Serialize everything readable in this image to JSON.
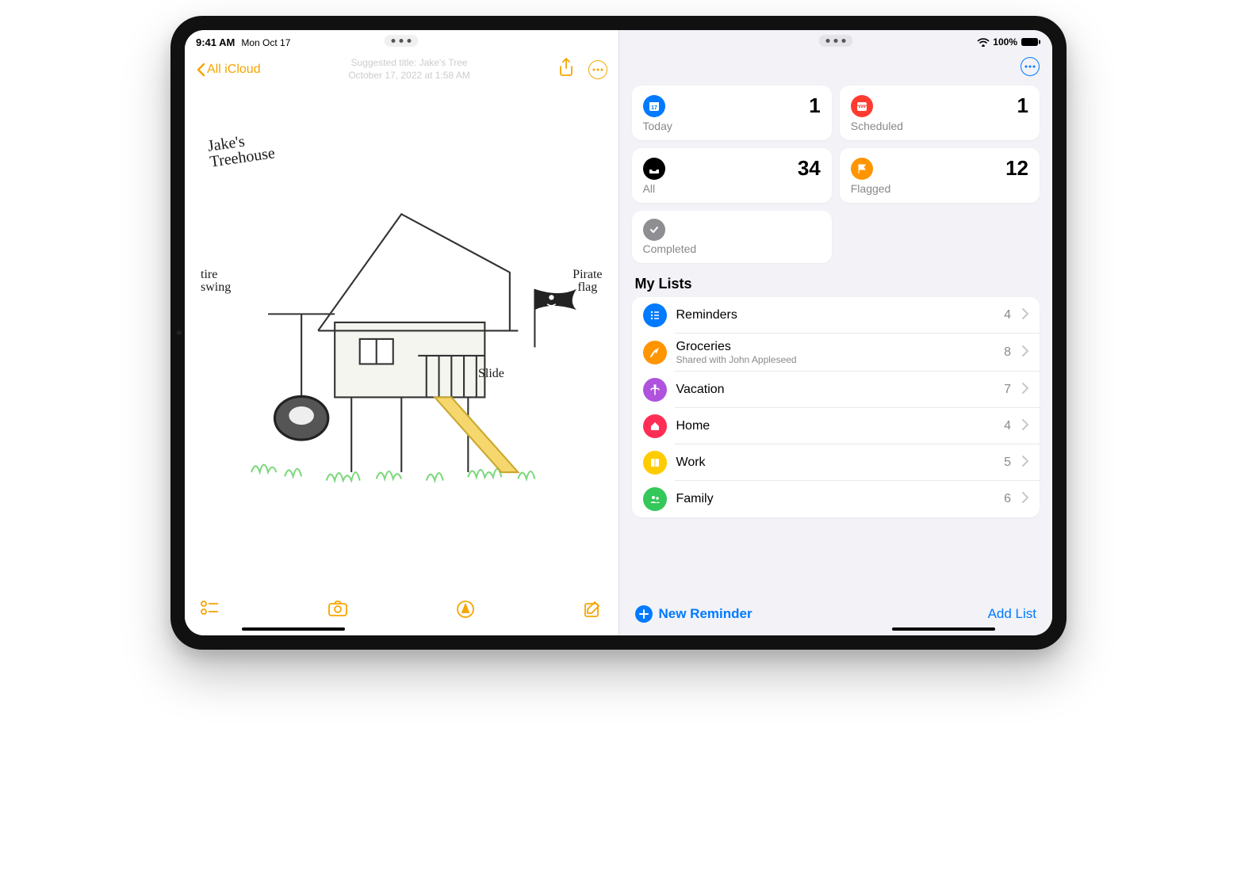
{
  "status": {
    "time": "9:41 AM",
    "date": "Mon Oct 17",
    "battery": "100%"
  },
  "notes": {
    "back_label": "All iCloud",
    "suggested_title": "Suggested title: Jake's Tree",
    "date_line": "October 17, 2022 at 1:58 AM",
    "labels": {
      "title": "Jake's\nTreehouse",
      "tire": "tire\nswing",
      "flag": "Pirate\nflag",
      "slide": "Slide"
    }
  },
  "reminders": {
    "smart": {
      "today": {
        "label": "Today",
        "count": "1",
        "color": "#007aff"
      },
      "scheduled": {
        "label": "Scheduled",
        "count": "1",
        "color": "#ff3b30"
      },
      "all": {
        "label": "All",
        "count": "34",
        "color": "#000"
      },
      "flagged": {
        "label": "Flagged",
        "count": "12",
        "color": "#ff9500"
      },
      "completed": {
        "label": "Completed",
        "count": "",
        "color": "#8e8e93"
      }
    },
    "my_lists_header": "My Lists",
    "lists": [
      {
        "name": "Reminders",
        "subtitle": "",
        "count": "4",
        "color": "#007aff",
        "icon": "list"
      },
      {
        "name": "Groceries",
        "subtitle": "Shared with John Appleseed",
        "count": "8",
        "color": "#ff9500",
        "icon": "carrot"
      },
      {
        "name": "Vacation",
        "subtitle": "",
        "count": "7",
        "color": "#af52de",
        "icon": "palm"
      },
      {
        "name": "Home",
        "subtitle": "",
        "count": "4",
        "color": "#ff2d55",
        "icon": "home"
      },
      {
        "name": "Work",
        "subtitle": "",
        "count": "5",
        "color": "#ffcc00",
        "icon": "book"
      },
      {
        "name": "Family",
        "subtitle": "",
        "count": "6",
        "color": "#34c759",
        "icon": "people"
      }
    ],
    "new_reminder": "New Reminder",
    "add_list": "Add List"
  }
}
